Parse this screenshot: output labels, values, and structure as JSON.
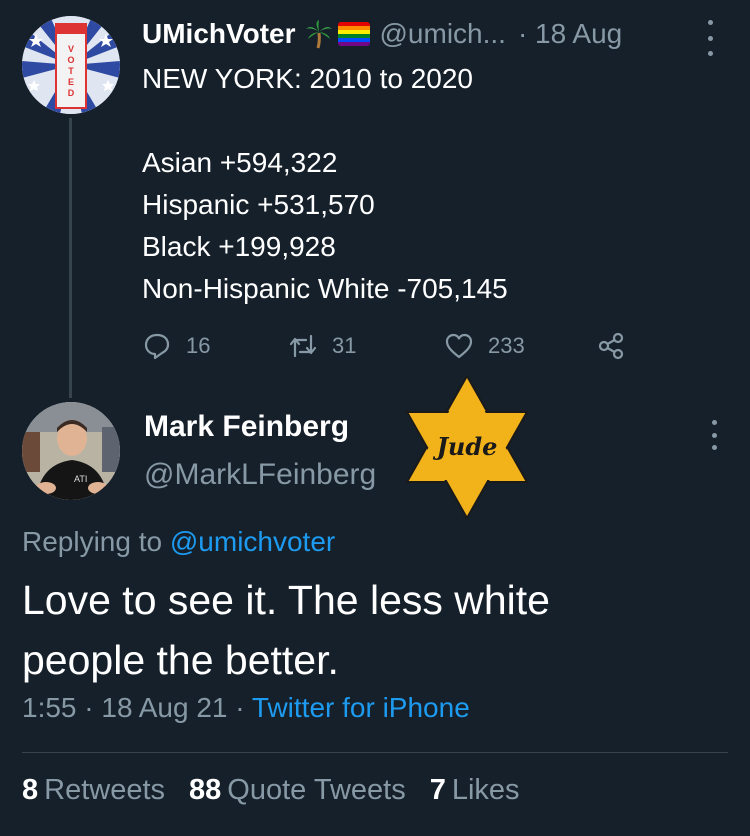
{
  "tweet1": {
    "display_name": "UMichVoter",
    "badge_icons": [
      "palm-tree-emoji",
      "rainbow-flag-emoji"
    ],
    "handle": "@umich...",
    "time": "· 18 Aug",
    "lines": [
      "NEW YORK: 2010 to 2020",
      "",
      "Asian +594,322",
      "Hispanic +531,570",
      "Black +199,928",
      "Non-Hispanic White -705,145"
    ],
    "actions": {
      "replies": "16",
      "retweets": "31",
      "likes": "233"
    },
    "avatar_text": "I VOTED"
  },
  "tweet2": {
    "display_name": "Mark Feinberg",
    "handle": "@MarkLFeinberg",
    "star_text": "Jude",
    "replying_prefix": "Replying to",
    "replying_to": "@umichvoter",
    "lines": [
      "Love to see it.  The less white",
      "people the better."
    ],
    "timestamp": "1:55 · 18 Aug 21 ·",
    "source": "Twitter for iPhone",
    "stats": [
      {
        "count": "8",
        "label": "Retweets"
      },
      {
        "count": "88",
        "label": "Quote Tweets"
      },
      {
        "count": "7",
        "label": "Likes"
      }
    ]
  },
  "colors": {
    "background": "#15202b",
    "secondary_text": "#8899a6",
    "link": "#1d9bf0",
    "divider": "#38444d",
    "star_fill": "#f2b21a"
  }
}
